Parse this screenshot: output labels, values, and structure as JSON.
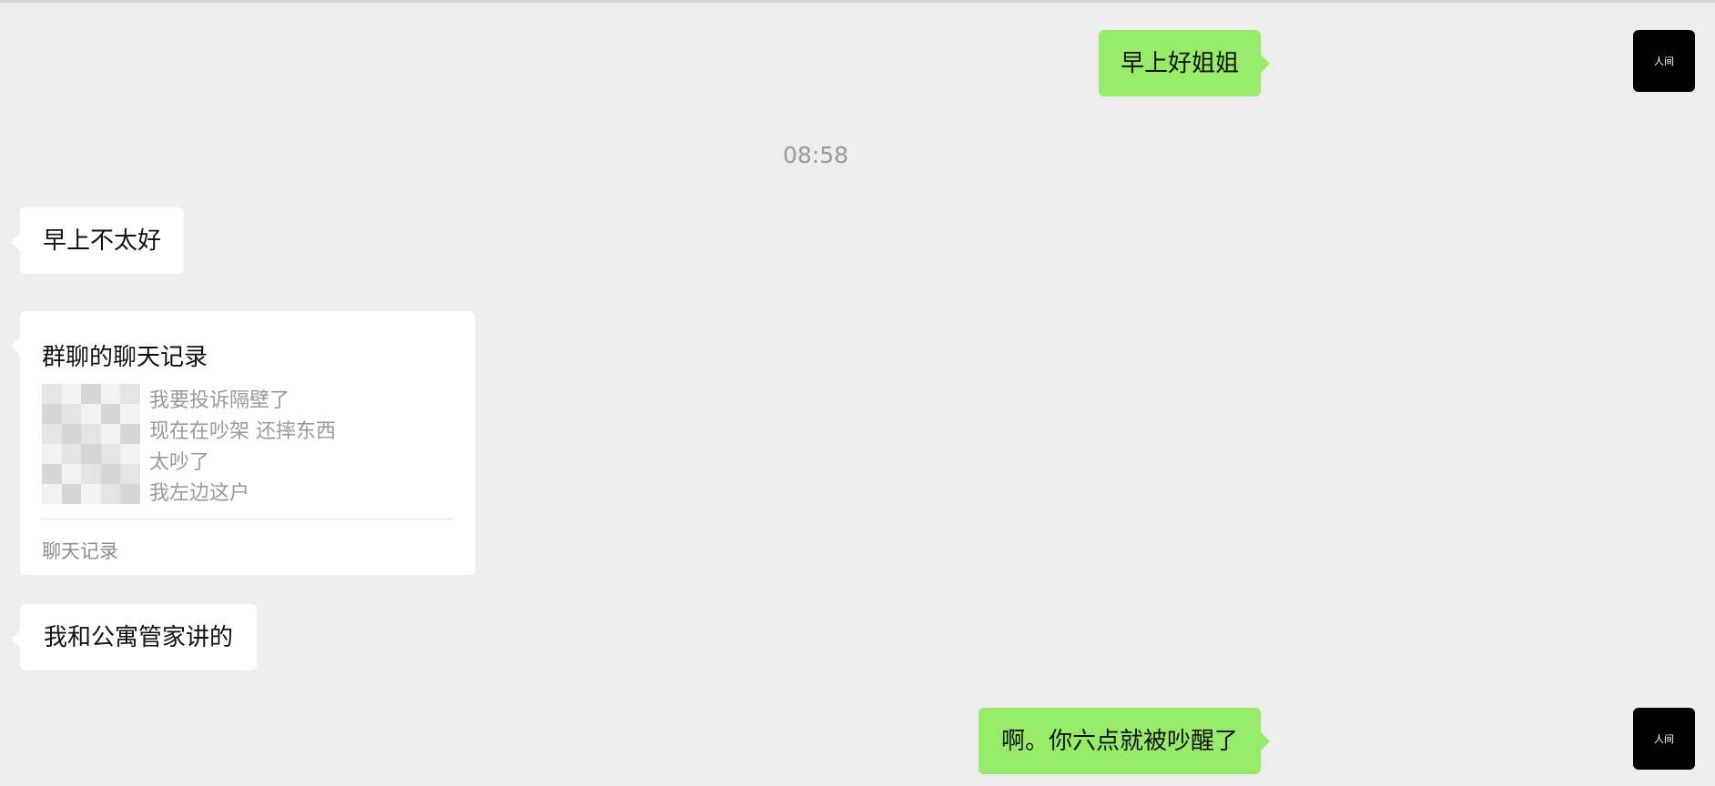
{
  "messages": {
    "m1": {
      "text": "早上好姐姐",
      "direction": "outgoing"
    },
    "time": "08:58",
    "m2": {
      "text": "早上不太好",
      "direction": "incoming"
    },
    "m3": {
      "title": "群聊的聊天记录",
      "lines": [
        "我要投诉隔壁了",
        "现在在吵架 还摔东西",
        "太吵了",
        "我左边这户"
      ],
      "footer": "聊天记录"
    },
    "m4": {
      "text": "我和公寓管家讲的",
      "direction": "incoming"
    },
    "m5": {
      "text": "啊。你六点就被吵醒了",
      "direction": "outgoing"
    }
  },
  "avatar": {
    "text": "人间",
    "color": "#000000"
  },
  "colors": {
    "outgoing_bubble": "#95ec69",
    "incoming_bubble": "#ffffff",
    "background": "#ededed"
  }
}
